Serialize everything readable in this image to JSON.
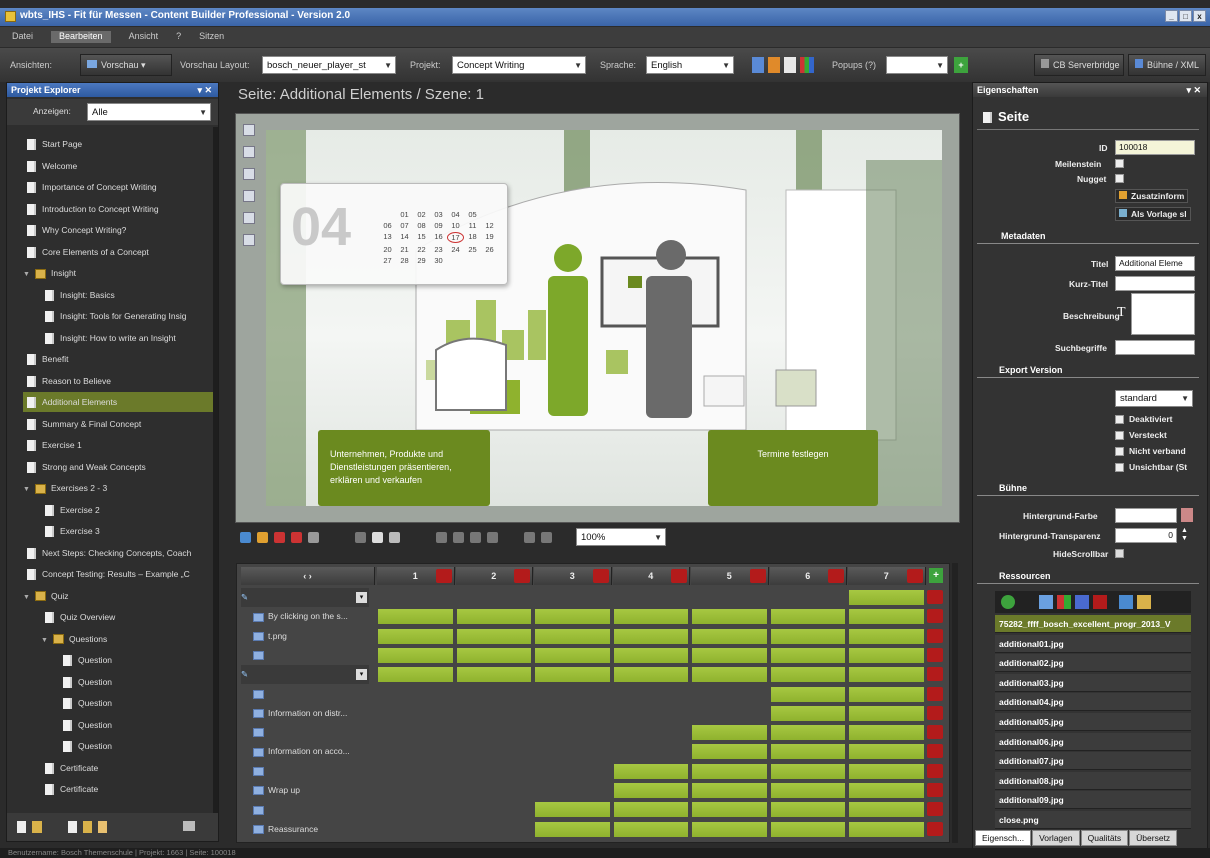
{
  "window": {
    "title": "wbts_IHS - Fit für Messen - Content Builder Professional - Version 2.0",
    "controls": [
      "_",
      "□",
      "x"
    ]
  },
  "menu": [
    "Datei",
    "Bearbeiten",
    "Ansicht",
    "?",
    "Sitzen"
  ],
  "menu_active": "Bearbeiten",
  "toolbar": {
    "ansichten_label": "Ansichten:",
    "vorschau": "Vorschau",
    "vorschau_layout_label": "Vorschau Layout:",
    "vorschau_layout_value": "bosch_neuer_player_st",
    "projekt_label": "Projekt:",
    "projekt_value": "Concept Writing",
    "sprache_label": "Sprache:",
    "sprache_value": "English",
    "popups_label": "Popups (?)",
    "cb_serverbridge": "CB Serverbridge",
    "buehne_xml": "Bühne / XML"
  },
  "explorer": {
    "title": "Projekt Explorer",
    "anzeigen_label": "Anzeigen:",
    "anzeigen_value": "Alle",
    "items": [
      {
        "label": "Start Page",
        "type": "doc",
        "level": 0
      },
      {
        "label": "Welcome",
        "type": "doc",
        "level": 0
      },
      {
        "label": "Importance of Concept Writing",
        "type": "doc",
        "level": 0
      },
      {
        "label": "Introduction to Concept Writing",
        "type": "doc",
        "level": 0
      },
      {
        "label": "Why Concept Writing?",
        "type": "doc",
        "level": 0
      },
      {
        "label": "Core Elements of a Concept",
        "type": "doc",
        "level": 0
      },
      {
        "label": "Insight",
        "type": "folder",
        "level": 0
      },
      {
        "label": "Insight: Basics",
        "type": "doc",
        "level": 1
      },
      {
        "label": "Insight: Tools for Generating Insig",
        "type": "doc",
        "level": 1
      },
      {
        "label": "Insight: How to write an Insight",
        "type": "doc",
        "level": 1
      },
      {
        "label": "Benefit",
        "type": "doc",
        "level": 0
      },
      {
        "label": "Reason to Believe",
        "type": "doc",
        "level": 0
      },
      {
        "label": "Additional Elements",
        "type": "doc",
        "level": 0,
        "selected": true
      },
      {
        "label": "Summary & Final Concept",
        "type": "doc",
        "level": 0
      },
      {
        "label": "Exercise 1",
        "type": "doc",
        "level": 0
      },
      {
        "label": "Strong and Weak Concepts",
        "type": "doc",
        "level": 0
      },
      {
        "label": "Exercises 2 - 3",
        "type": "folder",
        "level": 0
      },
      {
        "label": "Exercise 2",
        "type": "doc",
        "level": 1
      },
      {
        "label": "Exercise 3",
        "type": "doc",
        "level": 1
      },
      {
        "label": "Next Steps: Checking Concepts, Coach",
        "type": "doc",
        "level": 0
      },
      {
        "label": "Concept Testing: Results – Example „C",
        "type": "doc",
        "level": 0
      },
      {
        "label": "Quiz",
        "type": "folder",
        "level": 0
      },
      {
        "label": "Quiz Overview",
        "type": "doc",
        "level": 1
      },
      {
        "label": "Questions",
        "type": "folder",
        "level": 1
      },
      {
        "label": "Question",
        "type": "doc",
        "level": 2
      },
      {
        "label": "Question",
        "type": "doc",
        "level": 2
      },
      {
        "label": "Question",
        "type": "doc",
        "level": 2
      },
      {
        "label": "Question",
        "type": "doc",
        "level": 2
      },
      {
        "label": "Question",
        "type": "doc",
        "level": 2
      },
      {
        "label": "Certificate",
        "type": "doc",
        "level": 1
      },
      {
        "label": "Certificate",
        "type": "doc",
        "level": 1
      }
    ]
  },
  "center": {
    "title": "Seite: Additional Elements / Szene: 1",
    "zoom": "100%",
    "stage": {
      "cal_number": "04",
      "cal_days": [
        "",
        "01",
        "02",
        "03",
        "04",
        "05",
        "",
        "06",
        "07",
        "08",
        "09",
        "10",
        "11",
        "12",
        "13",
        "14",
        "15",
        "16",
        "17",
        "18",
        "19",
        "20",
        "21",
        "22",
        "23",
        "24",
        "25",
        "26",
        "27",
        "28",
        "29",
        "30",
        "",
        "",
        ""
      ],
      "callout_left": "Unternehmen, Produkte und Dienstleistungen präsentieren, erklären und verkaufen",
      "callout_right": "Termine festlegen"
    }
  },
  "timeline": {
    "columns": [
      "1",
      "2",
      "3",
      "4",
      "5",
      "6",
      "7"
    ],
    "rows": [
      {
        "label": "",
        "kind": "group",
        "bars": [
          0,
          0,
          0,
          0,
          0,
          0,
          1
        ]
      },
      {
        "label": "By clicking on the s...",
        "kind": "item",
        "bars": [
          1,
          1,
          1,
          1,
          1,
          1,
          1
        ]
      },
      {
        "label": "t.png",
        "kind": "item",
        "bars": [
          1,
          1,
          1,
          1,
          1,
          1,
          1
        ]
      },
      {
        "label": "",
        "kind": "item",
        "bars": [
          1,
          1,
          1,
          1,
          1,
          1,
          1
        ]
      },
      {
        "label": "",
        "kind": "group",
        "bars": [
          1,
          1,
          1,
          1,
          1,
          1,
          1
        ]
      },
      {
        "label": "",
        "kind": "item",
        "bars": [
          0,
          0,
          0,
          0,
          0,
          1,
          1
        ]
      },
      {
        "label": "Information on distr...",
        "kind": "item",
        "bars": [
          0,
          0,
          0,
          0,
          0,
          1,
          1
        ]
      },
      {
        "label": "",
        "kind": "item",
        "bars": [
          0,
          0,
          0,
          0,
          1,
          1,
          1
        ]
      },
      {
        "label": "Information on acco...",
        "kind": "item",
        "bars": [
          0,
          0,
          0,
          0,
          1,
          1,
          1
        ]
      },
      {
        "label": "",
        "kind": "item",
        "bars": [
          0,
          0,
          0,
          1,
          1,
          1,
          1
        ]
      },
      {
        "label": "Wrap up",
        "kind": "item",
        "bars": [
          0,
          0,
          0,
          1,
          1,
          1,
          1
        ]
      },
      {
        "label": "",
        "kind": "item",
        "bars": [
          0,
          0,
          1,
          1,
          1,
          1,
          1
        ]
      },
      {
        "label": "Reassurance",
        "kind": "item",
        "bars": [
          0,
          0,
          1,
          1,
          1,
          1,
          1
        ]
      }
    ]
  },
  "props": {
    "title": "Eigenschaften",
    "heading": "Seite",
    "id_label": "ID",
    "id_value": "100018",
    "meilenstein_label": "Meilenstein",
    "nugget_label": "Nugget",
    "zusatzinfo": "Zusatzinform",
    "als_vorlage": "Als Vorlage sl",
    "metadaten": "Metadaten",
    "titel_label": "Titel",
    "titel_value": "Additional Eleme",
    "kurztitel_label": "Kurz-Titel",
    "beschreibung_label": "Beschreibung",
    "suchbegriffe_label": "Suchbegriffe",
    "export_version": "Export Version",
    "export_value": "standard",
    "checks": [
      "Deaktiviert",
      "Versteckt",
      "Nicht verband",
      "Unsichtbar (St"
    ],
    "buehne": "Bühne",
    "hintergrund_farbe": "Hintergrund-Farbe",
    "hintergrund_transparenz": "Hintergrund-Transparenz",
    "transparenz_value": "0",
    "hidescrollbar": "HideScrollbar",
    "ressourcen": "Ressourcen",
    "resources": [
      "75282_ffff_bosch_excellent_progr_2013_V",
      "additional01.jpg",
      "additional02.jpg",
      "additional03.jpg",
      "additional04.jpg",
      "additional05.jpg",
      "additional06.jpg",
      "additional07.jpg",
      "additional08.jpg",
      "additional09.jpg",
      "close.png"
    ],
    "tabs": [
      "Eigensch...",
      "Vorlagen",
      "Qualitäts",
      "Übersetz"
    ]
  },
  "status": "Benutzername: Bosch Themenschule | Projekt: 1663 | Seite: 100018",
  "colors": {
    "accent_green": "#8fb22e",
    "selection_green": "#6b7a2a",
    "panel_blue": "#2e5aa0",
    "delete_red": "#b31b1b"
  }
}
